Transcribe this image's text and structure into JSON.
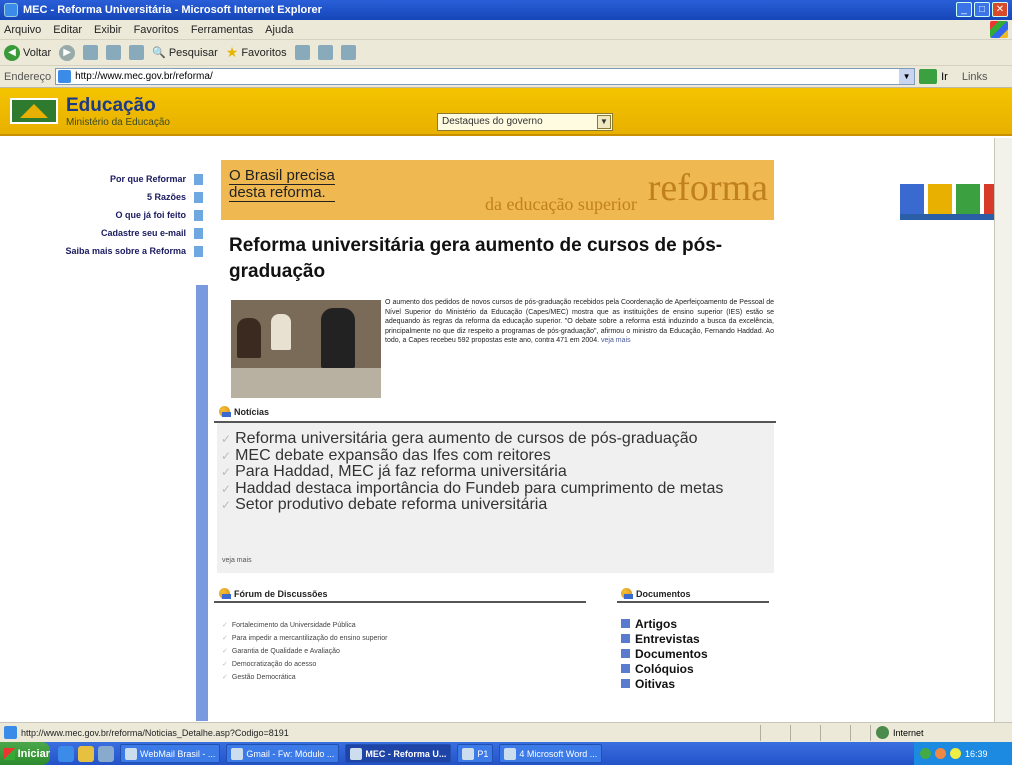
{
  "browser": {
    "title": "MEC - Reforma Universitária - Microsoft Internet Explorer",
    "menu": [
      "Arquivo",
      "Editar",
      "Exibir",
      "Favoritos",
      "Ferramentas",
      "Ajuda"
    ],
    "toolbar": {
      "back": "Voltar",
      "search": "Pesquisar",
      "favorites": "Favoritos"
    },
    "address_label": "Endereço",
    "address": "http://www.mec.gov.br/reforma/",
    "go": "Ir",
    "links": "Links"
  },
  "site": {
    "title": "Educação",
    "subtitle": "Ministério da Educação",
    "highlights_select": "Destaques do governo",
    "brasil_logo": "BRASIL"
  },
  "leftnav": [
    "Por que Reformar",
    "5 Razões",
    "O que já foi feito",
    "Cadastre seu e-mail",
    "Saiba mais sobre a Reforma"
  ],
  "banner": {
    "line1": "O Brasil precisa",
    "line2": "desta reforma.",
    "big": "reforma",
    "sub": "da educação superior"
  },
  "headline": "Reforma universitária gera aumento de cursos de pós-graduação",
  "summary": "O aumento dos pedidos de novos cursos de pós-graduação recebidos pela Coordenação de Aperfeiçoamento de Pessoal de Nível Superior do Ministério da Educação (Capes/MEC) mostra que as instituições de ensino superior (IES) estão se adequando às regras da reforma da educação superior. \"O debate sobre a reforma está induzindo a busca da excelência, principalmente no que diz respeito a programas de pós-graduação\", afirmou o ministro da Educação, Fernando Haddad. Ao todo, a Capes recebeu 592 propostas este ano, contra 471 em 2004.",
  "summary_more": "veja mais",
  "news": {
    "heading": "Notícias",
    "items": [
      "Reforma universitária gera aumento de cursos de pós-graduação",
      "MEC debate expansão das Ifes com reitores",
      "Para Haddad, MEC já faz reforma universitária",
      "Haddad destaca importância do Fundeb para cumprimento de metas",
      "Setor produtivo debate reforma universitária"
    ],
    "more": "veja mais"
  },
  "forum": {
    "heading": "Fórum de Discussões",
    "items": [
      "Fortalecimento da Universidade Pública",
      "Para impedir a mercantilização do ensino superior",
      "Garantia de Qualidade e Avaliação",
      "Democratização do acesso",
      "Gestão Democrática"
    ]
  },
  "docs": {
    "heading": "Documentos",
    "items": [
      "Artigos",
      "Entrevistas",
      "Documentos",
      "Colóquios",
      "Oitivas"
    ]
  },
  "status": {
    "url": "http://www.mec.gov.br/reforma/Noticias_Detalhe.asp?Codigo=8191",
    "zone": "Internet"
  },
  "taskbar": {
    "start": "Iniciar",
    "tasks": [
      "WebMail Brasil - ...",
      "Gmail - Fw: Módulo ...",
      "MEC - Reforma U...",
      "P1",
      "4 Microsoft Word ..."
    ],
    "clock": "16:39"
  }
}
